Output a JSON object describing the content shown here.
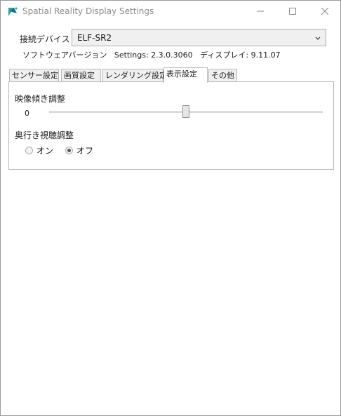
{
  "window": {
    "title": "Spatial Reality Display Settings",
    "app_icon": "sony-srd-logo-icon",
    "controls": [
      "minimize-icon",
      "maximize-icon",
      "close-icon"
    ]
  },
  "device": {
    "label": "接続デバイス",
    "selected": "ELF-SR2"
  },
  "version": {
    "software_label": "ソフトウェアバージョン",
    "settings": "Settings: 2.3.0.3060",
    "display": "ディスプレイ: 9.11.07"
  },
  "tabs": [
    {
      "label": "センサー設定"
    },
    {
      "label": "画質設定"
    },
    {
      "label": "レンダリング設定"
    },
    {
      "label": "表示設定"
    },
    {
      "label": "その他"
    }
  ],
  "active_tab": "表示設定",
  "display_settings": {
    "tilt": {
      "title": "映像傾き調整",
      "value": "0",
      "slider_fraction": 0.5
    },
    "depth": {
      "title": "奥行き視聴調整",
      "options": [
        {
          "label": "オン",
          "checked": false
        },
        {
          "label": "オフ",
          "checked": true
        }
      ]
    }
  }
}
